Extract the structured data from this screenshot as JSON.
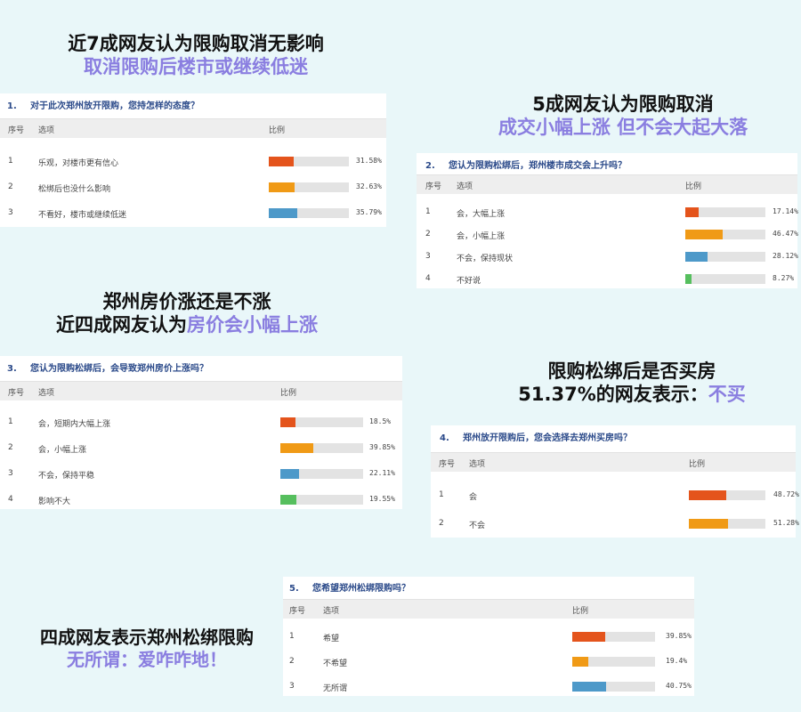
{
  "captions": {
    "c1": {
      "line1": "近7成网友认为限购取消无影响",
      "line2": "取消限购后楼市或继续低迷"
    },
    "c2": {
      "line1": "5成网友认为限购取消",
      "line2": "成交小幅上涨 但不会大起大落"
    },
    "c3": {
      "line1": "郑州房价涨还是不涨",
      "line2_black": "近四成网友认为",
      "line2_purple": "房价会小幅上涨"
    },
    "c4": {
      "line1": "限购松绑后是否买房",
      "line2_black": "51.37%的网友表示：",
      "line2_purple": "不买"
    },
    "c5": {
      "line1": "四成网友表示郑州松绑限购",
      "line2": "无所谓：爱咋咋地！"
    }
  },
  "table_headers": {
    "num": "序号",
    "option": "选项",
    "ratio": "比例"
  },
  "colors": {
    "orange_red": "#e4541c",
    "orange": "#f09a16",
    "blue": "#4d99c9",
    "green": "#56bf5e",
    "purple": "#8a7ee0"
  },
  "chart_data": [
    {
      "type": "bar",
      "qnum": "1.",
      "title": "对于此次郑州放开限购，您持怎样的态度？",
      "categories": [
        "乐观，对楼市更有信心",
        "松绑后也没什么影响",
        "不看好，楼市或继续低迷"
      ],
      "row_nums": [
        "1",
        "2",
        "3"
      ],
      "values": [
        31.58,
        32.63,
        35.79
      ],
      "labels": [
        "31.58%",
        "32.63%",
        "35.79%"
      ],
      "colors": [
        "#e4541c",
        "#f09a16",
        "#4d99c9"
      ],
      "xlim": [
        0,
        100
      ]
    },
    {
      "type": "bar",
      "qnum": "2.",
      "title": "您认为限购松绑后，郑州楼市成交会上升吗？",
      "categories": [
        "会，大幅上涨",
        "会，小幅上涨",
        "不会，保持现状",
        "不好说"
      ],
      "row_nums": [
        "1",
        "2",
        "3",
        "4"
      ],
      "values": [
        17.14,
        46.47,
        28.12,
        8.27
      ],
      "labels": [
        "17.14%",
        "46.47%",
        "28.12%",
        "8.27%"
      ],
      "colors": [
        "#e4541c",
        "#f09a16",
        "#4d99c9",
        "#56bf5e"
      ],
      "xlim": [
        0,
        100
      ]
    },
    {
      "type": "bar",
      "qnum": "3.",
      "title": "您认为限购松绑后，会导致郑州房价上涨吗？",
      "categories": [
        "会，短期内大幅上涨",
        "会，小幅上涨",
        "不会，保持平稳",
        "影响不大"
      ],
      "row_nums": [
        "1",
        "2",
        "3",
        "4"
      ],
      "values": [
        18.5,
        39.85,
        22.11,
        19.55
      ],
      "labels": [
        "18.5%",
        "39.85%",
        "22.11%",
        "19.55%"
      ],
      "colors": [
        "#e4541c",
        "#f09a16",
        "#4d99c9",
        "#56bf5e"
      ],
      "xlim": [
        0,
        100
      ]
    },
    {
      "type": "bar",
      "qnum": "4.",
      "title": "郑州放开限购后，您会选择去郑州买房吗？",
      "categories": [
        "会",
        "不会"
      ],
      "row_nums": [
        "1",
        "2"
      ],
      "values": [
        48.72,
        51.28
      ],
      "labels": [
        "48.72%",
        "51.28%"
      ],
      "colors": [
        "#e4541c",
        "#f09a16"
      ],
      "xlim": [
        0,
        100
      ]
    },
    {
      "type": "bar",
      "qnum": "5.",
      "title": "您希望郑州松绑限购吗？",
      "categories": [
        "希望",
        "不希望",
        "无所谓"
      ],
      "row_nums": [
        "1",
        "2",
        "3"
      ],
      "values": [
        39.85,
        19.4,
        40.75
      ],
      "labels": [
        "39.85%",
        "19.4%",
        "40.75%"
      ],
      "colors": [
        "#e4541c",
        "#f09a16",
        "#4d99c9"
      ],
      "xlim": [
        0,
        100
      ]
    }
  ]
}
